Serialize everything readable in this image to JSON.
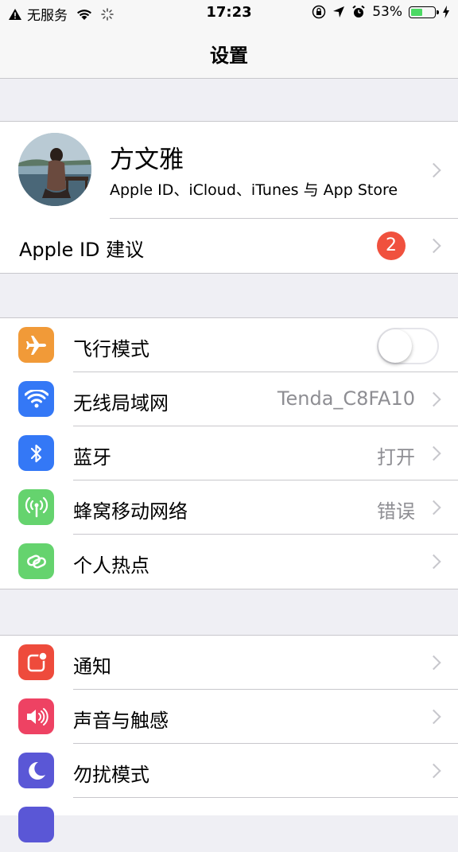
{
  "status_bar": {
    "carrier": "无服务",
    "time": "17:23",
    "battery_percent": "53%",
    "battery_level": 0.53,
    "icons": [
      "warning-icon",
      "wifi-icon",
      "activity-spinner-icon",
      "orientation-lock-icon",
      "location-icon",
      "alarm-icon",
      "charging-icon"
    ]
  },
  "nav": {
    "title": "设置"
  },
  "profile": {
    "name": "方文雅",
    "subtitle": "Apple ID、iCloud、iTunes 与 App Store"
  },
  "apple_id_suggestion": {
    "label": "Apple ID 建议",
    "badge": "2",
    "badge_color": "#f0513e"
  },
  "network_group": [
    {
      "label": "飞行模式",
      "icon": "airplane-icon",
      "color": "#f19a38",
      "toggle": false
    },
    {
      "label": "无线局域网",
      "icon": "wifi-icon",
      "color": "#3478f6",
      "value": "Tenda_C8FA10"
    },
    {
      "label": "蓝牙",
      "icon": "bluetooth-icon",
      "color": "#3478f6",
      "value": "打开"
    },
    {
      "label": "蜂窝移动网络",
      "icon": "cellular-icon",
      "color": "#65d36e",
      "value": "错误"
    },
    {
      "label": "个人热点",
      "icon": "hotspot-icon",
      "color": "#65d36e"
    }
  ],
  "notify_group": [
    {
      "label": "通知",
      "icon": "notifications-icon",
      "color": "#ee4b3c"
    },
    {
      "label": "声音与触感",
      "icon": "sound-icon",
      "color": "#ee4263"
    },
    {
      "label": "勿扰模式",
      "icon": "moon-icon",
      "color": "#5a57d6"
    }
  ]
}
